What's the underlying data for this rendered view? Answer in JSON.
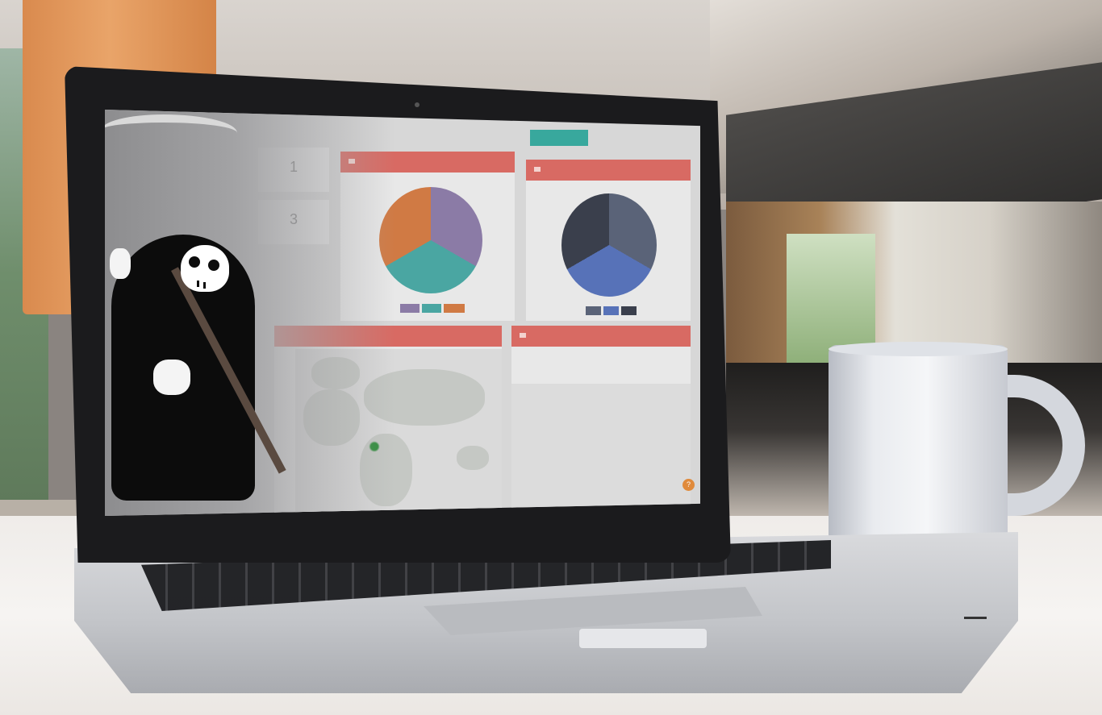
{
  "dashboard": {
    "action_button": "",
    "user_text": "",
    "stats": [
      {
        "value": "1",
        "label": ""
      },
      {
        "value": "3",
        "label": ""
      }
    ],
    "panels": {
      "chart_left_title": "",
      "chart_right_title": "",
      "map_title": "",
      "table_title": ""
    },
    "help_icon": "?"
  },
  "colors": {
    "panel_header": "#d86a63",
    "accent_button": "#38a89d",
    "pie_left": [
      "#8b7ba6",
      "#4aa6a2",
      "#d07a44"
    ],
    "pie_right": [
      "#5a6378",
      "#5772b8",
      "#3a3f4c"
    ],
    "map_highlight": "#2f8c3b",
    "help_button": "#e08a3b"
  },
  "icons": [
    "webcam-icon",
    "help-icon",
    "panel-header-icon"
  ],
  "chart_data": [
    {
      "type": "pie",
      "values": [
        33.3,
        33.3,
        33.3
      ],
      "colors": [
        "#8b7ba6",
        "#4aa6a2",
        "#d07a44"
      ]
    },
    {
      "type": "pie",
      "values": [
        33.3,
        33.3,
        33.3
      ],
      "colors": [
        "#5a6378",
        "#5772b8",
        "#3a3f4c"
      ]
    }
  ]
}
